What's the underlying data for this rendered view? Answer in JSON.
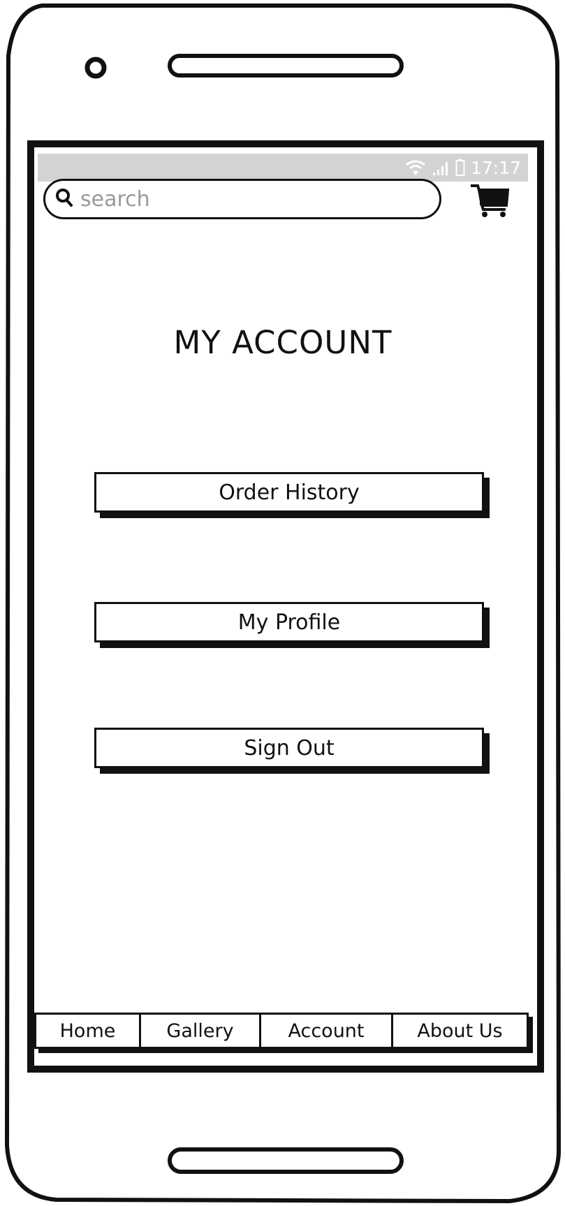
{
  "status_bar": {
    "time": "17:17"
  },
  "search": {
    "placeholder": "search"
  },
  "page": {
    "title": "MY ACCOUNT"
  },
  "menu": {
    "buttons": [
      {
        "label": "Order History"
      },
      {
        "label": "My Profile"
      },
      {
        "label": "Sign Out"
      }
    ]
  },
  "tab_bar": {
    "tabs": [
      {
        "label": "Home"
      },
      {
        "label": "Gallery"
      },
      {
        "label": "Account"
      },
      {
        "label": "About Us"
      }
    ]
  },
  "colors": {
    "status_bar_bg": "#d3d3d3",
    "ink": "#111111",
    "placeholder": "#9a9a9a"
  },
  "icons": [
    "search-icon",
    "cart-icon",
    "wifi-icon",
    "signal-icon",
    "battery-icon"
  ]
}
